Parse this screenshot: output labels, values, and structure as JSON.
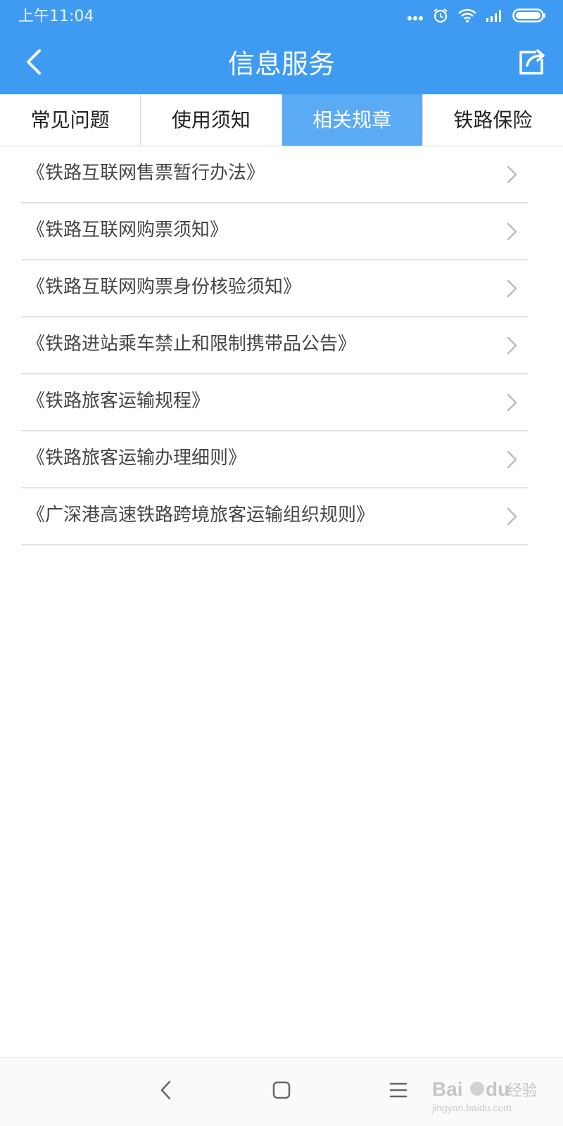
{
  "status_bar": {
    "time": "上午11:04",
    "icons": [
      "more-dots-icon",
      "alarm-icon",
      "wifi-icon",
      "signal-icon",
      "battery-icon"
    ]
  },
  "header": {
    "title": "信息服务",
    "back_icon": "chevron-left-icon",
    "share_icon": "share-icon",
    "background_color": "#3f9bf1"
  },
  "tabs": [
    {
      "label": "常见问题",
      "active": false
    },
    {
      "label": "使用须知",
      "active": false
    },
    {
      "label": "相关规章",
      "active": true
    },
    {
      "label": "铁路保险",
      "active": false
    }
  ],
  "active_tab_color": "#5aaaf4",
  "list_items": [
    {
      "label": "《铁路互联网售票暂行办法》"
    },
    {
      "label": "《铁路互联网购票须知》"
    },
    {
      "label": "《铁路互联网购票身份核验须知》"
    },
    {
      "label": "《铁路进站乘车禁止和限制携带品公告》"
    },
    {
      "label": "《铁路旅客运输规程》"
    },
    {
      "label": "《铁路旅客运输办理细则》"
    },
    {
      "label": "《广深港高速铁路跨境旅客运输组织规则》"
    }
  ],
  "nav_bar": {
    "buttons": [
      "back-nav-icon",
      "home-nav-icon",
      "menu-nav-icon"
    ]
  },
  "watermark": {
    "text": "Bai du 经验",
    "subtext": "jingyan.baidu.com"
  }
}
